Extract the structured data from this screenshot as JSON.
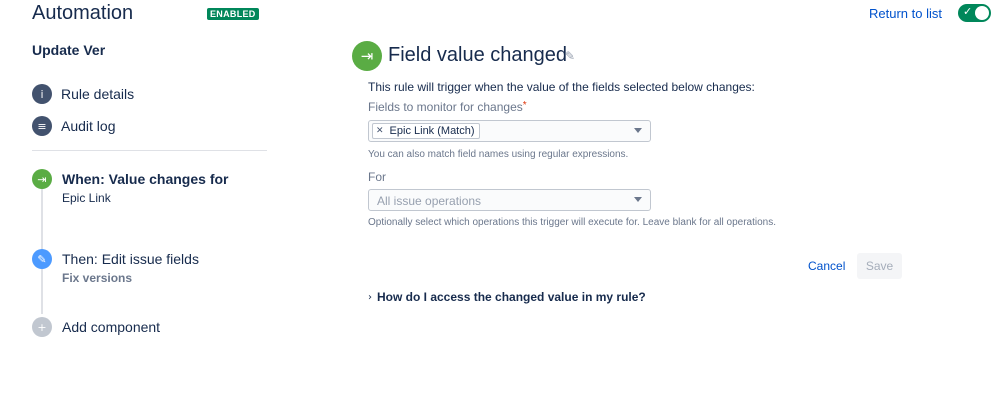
{
  "header": {
    "title": "Automation",
    "status_badge": "ENABLED",
    "return_link": "Return to list",
    "toggle_on": true,
    "accent_color": "#00875a"
  },
  "sidebar": {
    "rule_name": "Update Ver",
    "nav": [
      {
        "label": "Rule details",
        "icon": "info-icon"
      },
      {
        "label": "Audit log",
        "icon": "list-icon"
      }
    ],
    "components": [
      {
        "title": "When: Value changes for",
        "subtitle": "Epic Link",
        "icon": "trigger-icon",
        "color": "#5aac44"
      },
      {
        "title": "Then: Edit issue fields",
        "subtitle": "Fix versions",
        "icon": "pencil-icon",
        "color": "#4c9aff"
      },
      {
        "title": "Add component",
        "subtitle": "",
        "icon": "plus-icon",
        "color": "#c1c7d0"
      }
    ]
  },
  "main": {
    "title": "Field value changed",
    "description": "This rule will trigger when the value of the fields selected below changes:",
    "fields_label": "Fields to monitor for changes",
    "required_marker": "*",
    "selected_tag": "Epic Link (Match)",
    "fields_help": "You can also match field names using regular expressions.",
    "for_label": "For",
    "for_placeholder": "All issue operations",
    "for_help": "Optionally select which operations this trigger will execute for. Leave blank for all operations.",
    "cancel_label": "Cancel",
    "save_label": "Save",
    "faq_label": "How do I access the changed value in my rule?"
  }
}
